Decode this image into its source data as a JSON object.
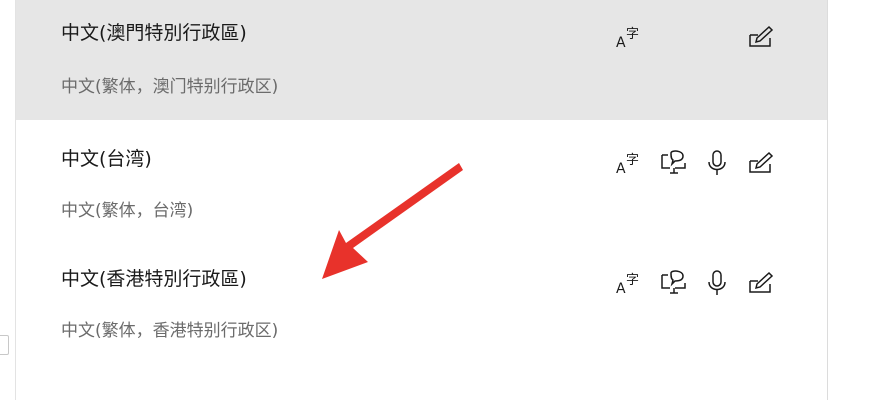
{
  "languages": [
    {
      "name": "中文(澳門特別行政區)",
      "description": "中文(繁体，澳门特别行政区)",
      "selected": true,
      "features": [
        "display-language-icon",
        "handwriting-icon"
      ]
    },
    {
      "name": "中文(台湾)",
      "description": "中文(繁体，台湾)",
      "selected": false,
      "features": [
        "display-language-icon",
        "text-to-speech-icon",
        "speech-recognition-icon",
        "handwriting-icon"
      ]
    },
    {
      "name": "中文(香港特別行政區)",
      "description": "中文(繁体，香港特别行政区)",
      "selected": false,
      "features": [
        "display-language-icon",
        "text-to-speech-icon",
        "speech-recognition-icon",
        "handwriting-icon"
      ]
    }
  ],
  "icon_glyphs": {
    "display_language": "A",
    "display_language_sub": "字"
  },
  "colors": {
    "selected_background": "#e6e6e6",
    "annotation_arrow": "#e8322b",
    "primary_text": "#1a1a1a",
    "secondary_text": "#6b6b6b"
  }
}
